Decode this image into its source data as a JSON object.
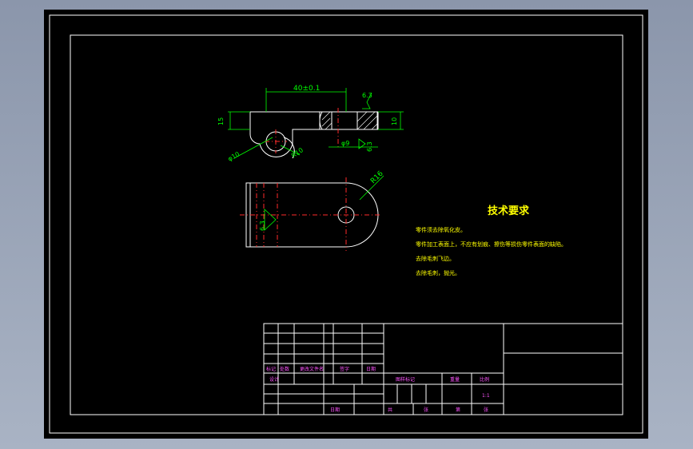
{
  "drawing": {
    "dims": {
      "length": "40±0.1",
      "height_left": "15",
      "height_right": "10",
      "hole_dia": "φ10",
      "radius_small": "R10",
      "slot_width": "φ9",
      "radius_top": "R16"
    },
    "roughness": {
      "top": "6.3",
      "side": "6.3",
      "lower_view": "6.3"
    }
  },
  "tech": {
    "title": "技术要求",
    "items": [
      "零件须去除氧化皮。",
      "零件加工表面上，不应有划痕、擦伤等损伤零件表面的缺陷。",
      "去除毛刺飞边。",
      "去除毛刺，抛光。"
    ]
  },
  "title_block": {
    "header": [
      "标记",
      "处数",
      "更改文件名",
      "签字",
      "日期"
    ],
    "design": "设计",
    "date": "日期",
    "stage_cols": [
      "图样标记",
      "重量",
      "比例"
    ],
    "scale": "1:1",
    "sheet_total": "共",
    "sheet_unit": "张",
    "sheet_no": "第",
    "sheet_unit2": "张"
  }
}
